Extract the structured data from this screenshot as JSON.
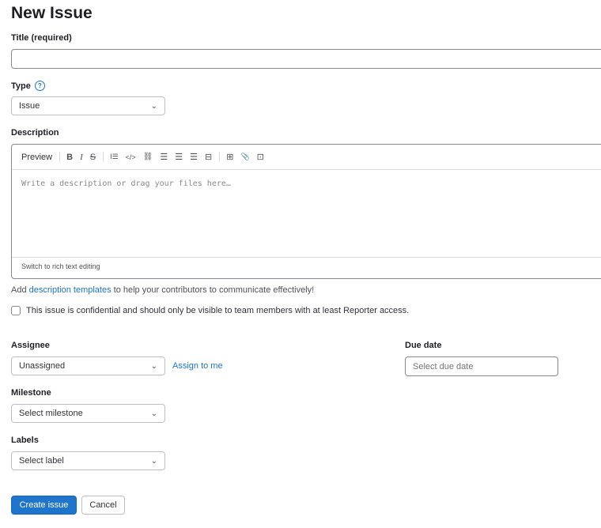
{
  "page": {
    "title": "New Issue"
  },
  "title_field": {
    "label": "Title (required)",
    "value": ""
  },
  "type_field": {
    "label": "Type",
    "help_glyph": "?",
    "selected": "Issue"
  },
  "description": {
    "label": "Description",
    "toolbar": {
      "preview": "Preview",
      "bold": "B",
      "italic": "I",
      "strike": "S",
      "quote": "I☰",
      "code": "</>",
      "link": "⛓",
      "bullet_list": "☰",
      "numbered_list": "☰",
      "task_list": "☰",
      "collapsible": "⊟",
      "table": "⊞",
      "attach": "📎",
      "fullscreen": "⊡"
    },
    "placeholder": "Write a description or drag your files here…",
    "switch_text": "Switch to rich text editing"
  },
  "templates_note": {
    "before": "Add ",
    "link": "description templates",
    "after": " to help your contributors to communicate effectively!"
  },
  "confidential": {
    "label": "This issue is confidential and should only be visible to team members with at least Reporter access.",
    "checked": false
  },
  "assignee": {
    "label": "Assignee",
    "selected": "Unassigned",
    "assign_me": "Assign to me"
  },
  "due_date": {
    "label": "Due date",
    "placeholder": "Select due date"
  },
  "milestone": {
    "label": "Milestone",
    "selected": "Select milestone"
  },
  "labels": {
    "label": "Labels",
    "selected": "Select label"
  },
  "actions": {
    "create": "Create issue",
    "cancel": "Cancel"
  },
  "colors": {
    "primary": "#1f75cb",
    "text": "#333238"
  }
}
